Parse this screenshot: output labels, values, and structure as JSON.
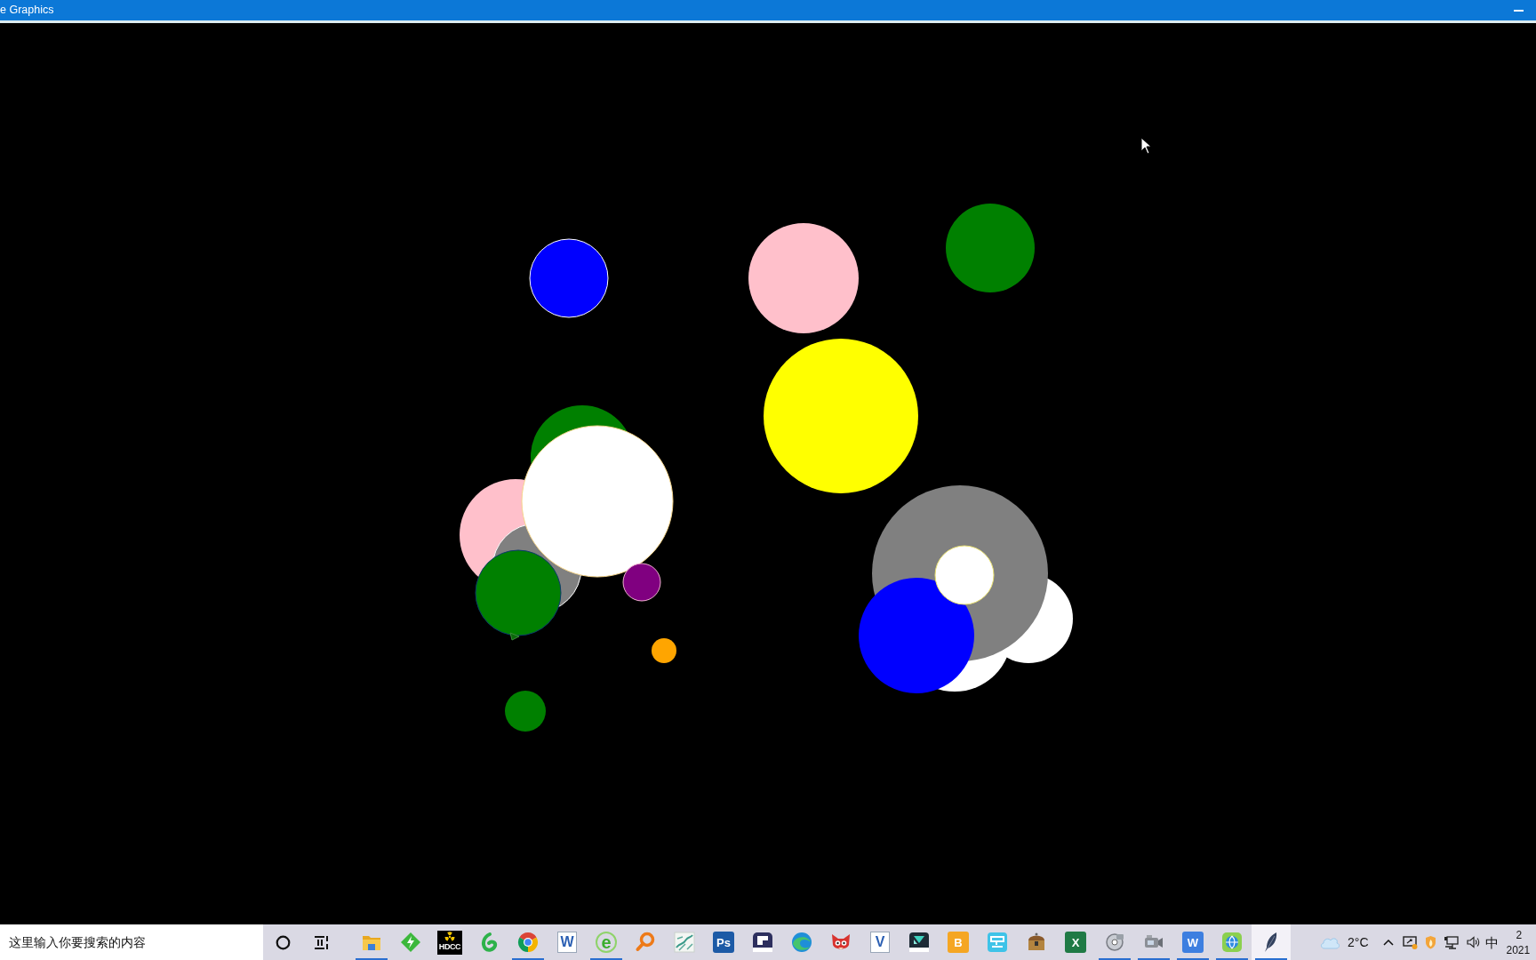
{
  "window": {
    "title": "e Graphics"
  },
  "canvas": {
    "circles": [
      {
        "color": "#0000ff"
      },
      {
        "color": "#ffc0cb"
      },
      {
        "color": "#008000"
      },
      {
        "color": "#ffff00"
      },
      {
        "color": "#008000"
      },
      {
        "color": "#ffc0cb"
      },
      {
        "color": "#808080"
      },
      {
        "color": "#008000"
      },
      {
        "color": "#ffffff"
      },
      {
        "color": "#800080"
      },
      {
        "color": "#ffa500"
      },
      {
        "color": "#008000"
      },
      {
        "color": "#ffffff"
      },
      {
        "color": "#ffffff"
      },
      {
        "color": "#808080"
      },
      {
        "color": "#0000ff"
      },
      {
        "color": "#ffffff"
      }
    ]
  },
  "taskbar": {
    "search": {
      "placeholder": "这里输入你要搜索的内容"
    },
    "apps": [
      {
        "kind": "folder",
        "running": true,
        "active": false
      },
      {
        "kind": "lightning",
        "running": false,
        "active": false
      },
      {
        "kind": "hazard",
        "label": "HDCC",
        "running": false,
        "active": false
      },
      {
        "kind": "swirl",
        "running": false,
        "active": false
      },
      {
        "kind": "browser",
        "running": true,
        "active": false
      },
      {
        "kind": "document",
        "label": "W",
        "running": false,
        "active": false
      },
      {
        "kind": "letter",
        "label": "e",
        "running": true,
        "active": false
      },
      {
        "kind": "magnifier",
        "running": false,
        "active": false
      },
      {
        "kind": "map",
        "running": false,
        "active": false
      },
      {
        "kind": "tile",
        "label": "Ps",
        "color": "#1c5aa6",
        "running": false,
        "active": false
      },
      {
        "kind": "board",
        "running": false,
        "active": false
      },
      {
        "kind": "wave",
        "running": false,
        "active": false
      },
      {
        "kind": "fox",
        "running": false,
        "active": false
      },
      {
        "kind": "document",
        "label": "V",
        "running": false,
        "active": false
      },
      {
        "kind": "film",
        "running": false,
        "active": false
      },
      {
        "kind": "tile",
        "label": "B",
        "color": "#f5a623",
        "running": false,
        "active": false
      },
      {
        "kind": "screen",
        "running": false,
        "active": false
      },
      {
        "kind": "chest",
        "running": false,
        "active": false
      },
      {
        "kind": "tile",
        "label": "X",
        "color": "#1f7a45",
        "running": false,
        "active": false
      },
      {
        "kind": "disc",
        "running": true,
        "active": false
      },
      {
        "kind": "camcorder",
        "running": true,
        "active": false
      },
      {
        "kind": "tile",
        "label": "W",
        "color": "#3d7fe0",
        "running": true,
        "active": false
      },
      {
        "kind": "globe",
        "running": true,
        "active": false
      },
      {
        "kind": "feather",
        "running": true,
        "active": true
      }
    ],
    "tray": {
      "weather": "2°C",
      "input_method": "中",
      "clock_time": "2",
      "clock_date": "2021"
    }
  }
}
